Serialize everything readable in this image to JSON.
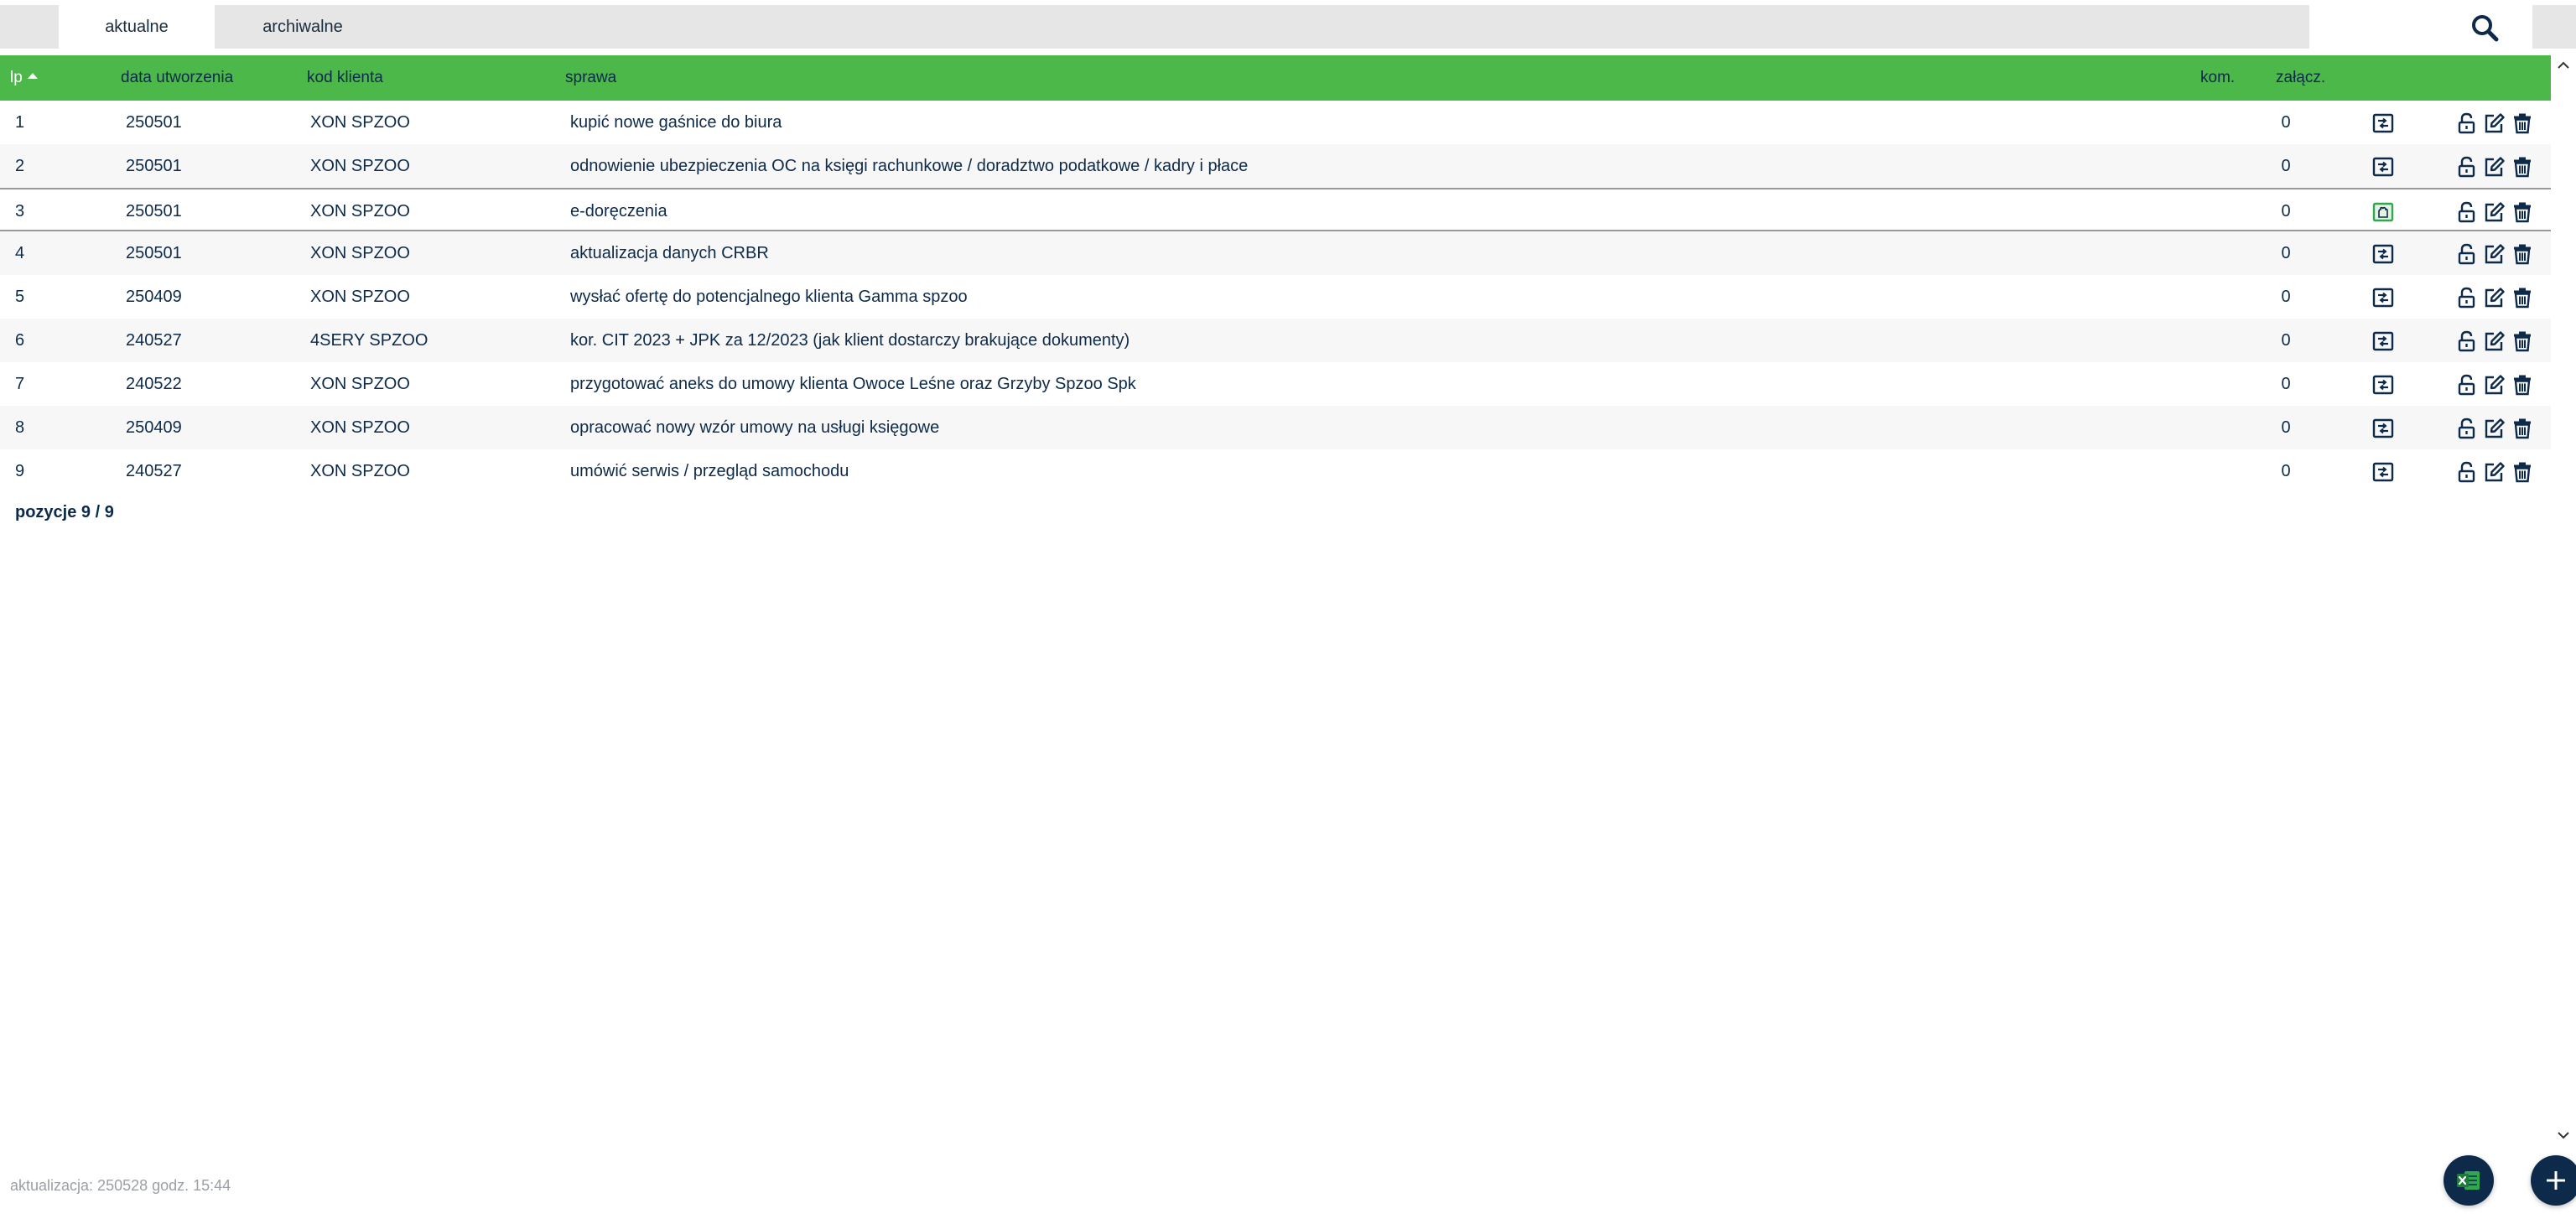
{
  "tabs": [
    {
      "label": "aktualne",
      "active": true
    },
    {
      "label": "archiwalne",
      "active": false
    }
  ],
  "icons": {
    "search": "search-icon",
    "details": "details-icon",
    "unlock": "unlock-icon",
    "edit": "edit-icon",
    "delete": "trash-icon",
    "excel": "excel-export-icon",
    "add": "plus-icon"
  },
  "colors": {
    "header_bg": "#4cb84a",
    "text": "#0d2a4a",
    "fab_bg": "#0d2a4a"
  },
  "table": {
    "columns": {
      "lp": "lp",
      "date": "data utworzenia",
      "kod": "kod klienta",
      "sprawa": "sprawa",
      "kom": "kom.",
      "zal": "załącz."
    },
    "sort": {
      "column": "lp",
      "direction": "asc"
    },
    "rows": [
      {
        "lp": "1",
        "date": "250501",
        "kod": "XON SPZOO",
        "sprawa": "kupić nowe gaśnice do biura",
        "zal": "0"
      },
      {
        "lp": "2",
        "date": "250501",
        "kod": "XON SPZOO",
        "sprawa": "odnowienie ubezpieczenia OC na księgi rachunkowe / doradztwo podatkowe / kadry i płace",
        "zal": "0"
      },
      {
        "lp": "3",
        "date": "250501",
        "kod": "XON SPZOO",
        "sprawa": "e-doręczenia",
        "zal": "0"
      },
      {
        "lp": "4",
        "date": "250501",
        "kod": "XON SPZOO",
        "sprawa": "aktualizacja danych CRBR",
        "zal": "0"
      },
      {
        "lp": "5",
        "date": "250409",
        "kod": "XON SPZOO",
        "sprawa": "wysłać ofertę do potencjalnego klienta Gamma spzoo",
        "zal": "0"
      },
      {
        "lp": "6",
        "date": "240527",
        "kod": "4SERY SPZOO",
        "sprawa": "kor. CIT 2023 + JPK za 12/2023 (jak klient dostarczy brakujące dokumenty)",
        "zal": "0"
      },
      {
        "lp": "7",
        "date": "240522",
        "kod": "XON SPZOO",
        "sprawa": "przygotować aneks do umowy klienta Owoce Leśne oraz Grzyby Spzoo Spk",
        "zal": "0"
      },
      {
        "lp": "8",
        "date": "250409",
        "kod": "XON SPZOO",
        "sprawa": "opracować nowy wzór umowy na usługi księgowe",
        "zal": "0"
      },
      {
        "lp": "9",
        "date": "240527",
        "kod": "XON SPZOO",
        "sprawa": "umówić serwis / przegląd samochodu",
        "zal": "0"
      }
    ],
    "highlighted_row": 3
  },
  "count_label": "pozycje 9 / 9",
  "updated_label": "aktualizacja: 250528 godz. 15:44"
}
